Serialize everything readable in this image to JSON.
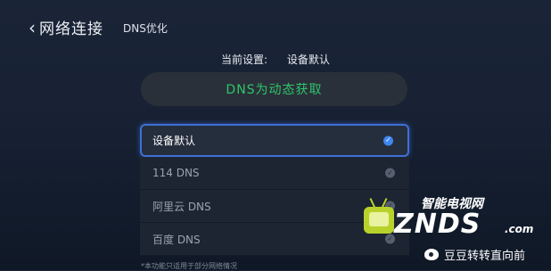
{
  "header": {
    "back_chevron": "‹",
    "title": "网络连接",
    "breadcrumb": "DNS优化"
  },
  "current_setting": {
    "label": "当前设置:",
    "value": "设备默认"
  },
  "status": {
    "text": "DNS为动态获取",
    "color": "#2dc56a"
  },
  "options": [
    {
      "label": "设备默认",
      "selected": true
    },
    {
      "label": "114 DNS",
      "selected": false
    },
    {
      "label": "阿里云 DNS",
      "selected": false
    },
    {
      "label": "百度 DNS",
      "selected": false
    }
  ],
  "check_glyph": "✓",
  "footnote": "*本功能只适用于部分网络情况",
  "watermark": {
    "cn": "智能电视网",
    "brand": "ZNDS",
    "domain": ".com",
    "icon": "tv-logo-icon"
  },
  "weibo": {
    "icon": "weibo-icon",
    "handle": "豆豆转转直向前"
  },
  "colors": {
    "accent": "#3f86f0",
    "status_green": "#2dc56a",
    "background": "#172133"
  }
}
